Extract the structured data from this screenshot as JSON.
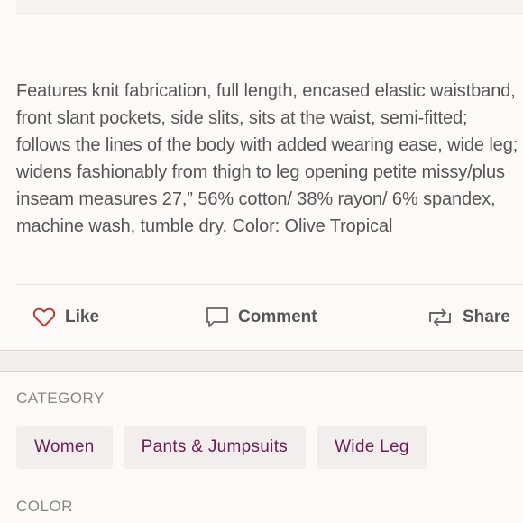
{
  "description": "Features knit fabrication, full length, encased elastic waistband, front slant pockets, side slits, sits at the waist, semi-fitted; follows the lines of the body with added wearing ease, wide leg; widens fashionably from thigh to leg opening petite missy/plus inseam measures 27,” 56% cotton/ 38% rayon/ 6% spandex, machine wash, tumble dry. Color: Olive Tropical",
  "actions": {
    "like": {
      "label": "Like",
      "icon": "heart-icon",
      "color": "#c0392b"
    },
    "comment": {
      "label": "Comment",
      "icon": "speech-bubble-icon"
    },
    "share": {
      "label": "Share",
      "icon": "repost-icon"
    }
  },
  "category": {
    "title": "CATEGORY",
    "tags": [
      "Women",
      "Pants & Jumpsuits",
      "Wide Leg"
    ]
  },
  "color": {
    "title": "COLOR"
  },
  "colors": {
    "accent": "#6b1e4f",
    "text": "#555555",
    "muted": "#8a8585"
  }
}
